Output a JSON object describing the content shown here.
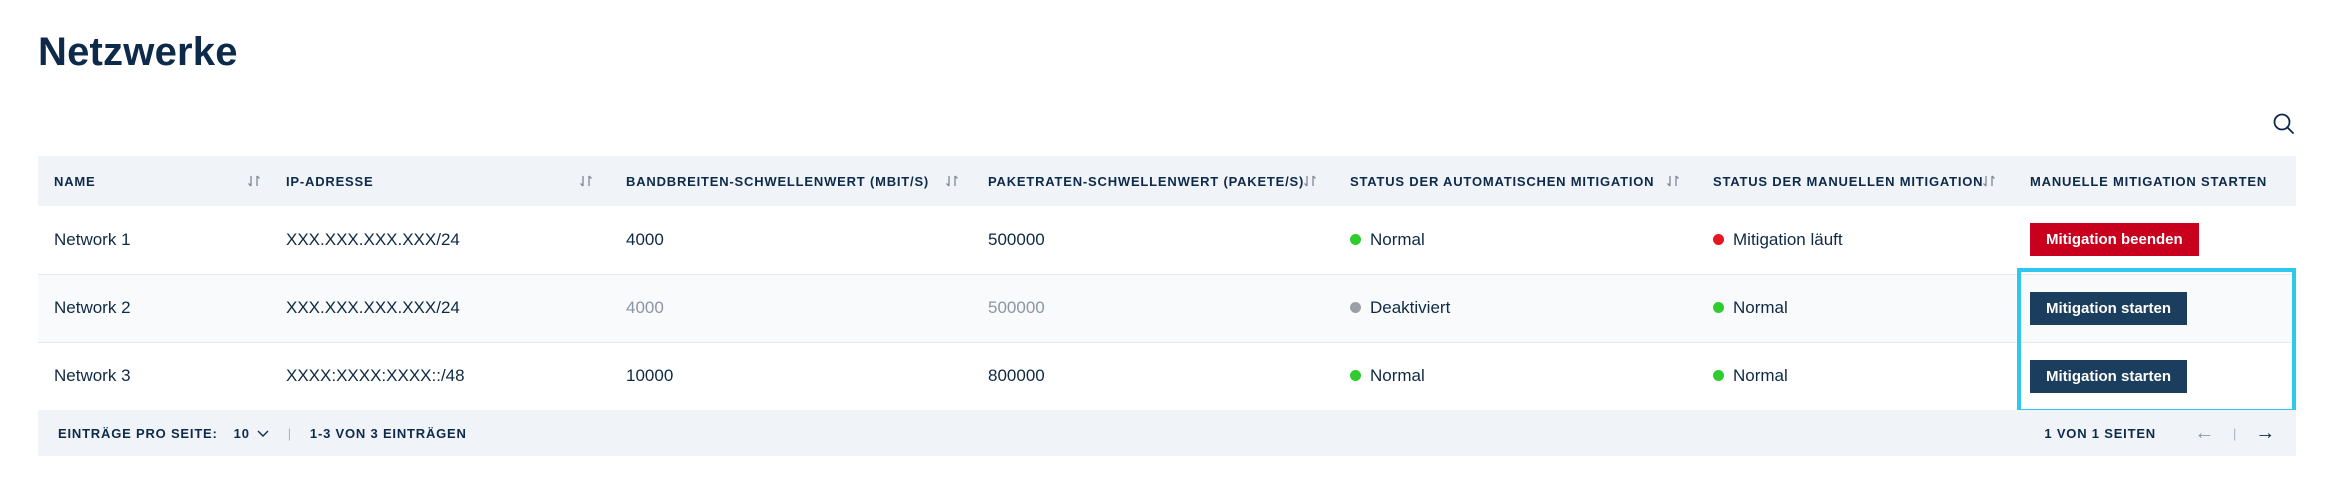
{
  "page": {
    "title": "Netzwerke"
  },
  "table": {
    "columns": [
      "NAME",
      "IP-ADRESSE",
      "BANDBREITEN-SCHWELLENWERT (MBIT/S)",
      "PAKETRATEN-SCHWELLENWERT (PAKETE/S)",
      "STATUS DER AUTOMATISCHEN MITIGATION",
      "STATUS DER MANUELLEN MITIGATION",
      "MANUELLE MITIGATION STARTEN"
    ],
    "rows": [
      {
        "name": "Network 1",
        "ip": "XXX.XXX.XXX.XXX/24",
        "bandwidth": "4000",
        "packet_rate": "500000",
        "auto_status": "Normal",
        "manual_status": "Mitigation läuft",
        "action": "Mitigation beenden"
      },
      {
        "name": "Network 2",
        "ip": "XXX.XXX.XXX.XXX/24",
        "bandwidth": "4000",
        "packet_rate": "500000",
        "auto_status": "Deaktiviert",
        "manual_status": "Normal",
        "action": "Mitigation starten"
      },
      {
        "name": "Network 3",
        "ip": "XXXX:XXXX:XXXX::/48",
        "bandwidth": "10000",
        "packet_rate": "800000",
        "auto_status": "Normal",
        "manual_status": "Normal",
        "action": "Mitigation starten"
      }
    ]
  },
  "footer": {
    "per_page_label": "EINTRÄGE PRO SEITE:",
    "per_page_value": "10",
    "range_label": "1-3 VON 3 EINTRÄGEN",
    "page_label": "1 VON 1 SEITEN",
    "prev_arrow": "←",
    "next_arrow": "→",
    "divider": "|"
  },
  "colors": {
    "status_green": "#2ecc2e",
    "status_red": "#e8141e",
    "status_grey": "#9aa0a6",
    "button_end": "#c8001e",
    "button_start": "#1c3e5e",
    "highlight": "#2ec8ee"
  },
  "icons": {
    "search": "search-icon",
    "sort": "sort-icon",
    "chevron": "chevron-down-icon"
  }
}
